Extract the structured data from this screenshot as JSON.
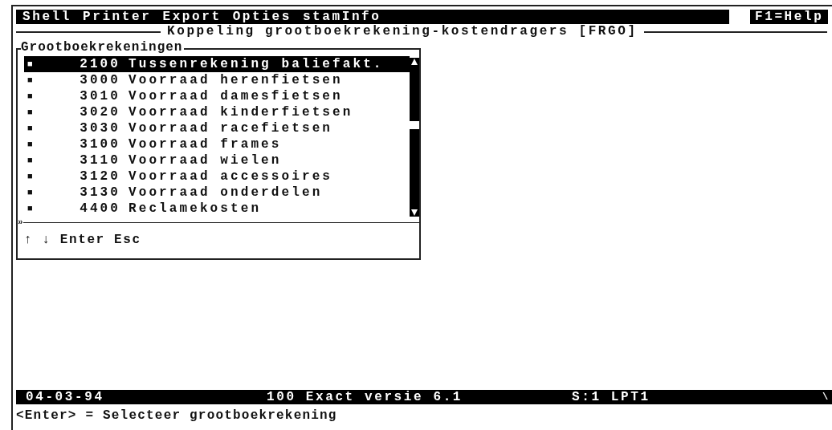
{
  "menu_bar": {
    "items": [
      {
        "label": "Shell"
      },
      {
        "label": "Printer"
      },
      {
        "label": "Export"
      },
      {
        "label": "Opties"
      },
      {
        "label": "stamInfo"
      }
    ],
    "help": "F1=Help"
  },
  "screen_title": "Koppeling grootboekrekening-kostendragers [FRGO]",
  "list_box": {
    "title": "Grootboekrekeningen",
    "items": [
      {
        "marker": "■",
        "code": "2100",
        "name": "Tussenrekening baliefakt.",
        "selected": true
      },
      {
        "marker": "■",
        "code": "3000",
        "name": "Voorraad herenfietsen",
        "selected": false
      },
      {
        "marker": "■",
        "code": "3010",
        "name": "Voorraad damesfietsen",
        "selected": false
      },
      {
        "marker": "■",
        "code": "3020",
        "name": "Voorraad kinderfietsen",
        "selected": false
      },
      {
        "marker": "■",
        "code": "3030",
        "name": "Voorraad racefietsen",
        "selected": false
      },
      {
        "marker": "■",
        "code": "3100",
        "name": "Voorraad frames",
        "selected": false
      },
      {
        "marker": "■",
        "code": "3110",
        "name": "Voorraad wielen",
        "selected": false
      },
      {
        "marker": "■",
        "code": "3120",
        "name": "Voorraad accessoires",
        "selected": false
      },
      {
        "marker": "■",
        "code": "3130",
        "name": "Voorraad onderdelen",
        "selected": false
      },
      {
        "marker": "■",
        "code": "4400",
        "name": "Reclamekosten",
        "selected": false
      }
    ],
    "more_marker": "»",
    "keys": "↑ ↓ Enter Esc"
  },
  "status_bar": {
    "date": "04-03-94",
    "version": "100 Exact versie 6.1",
    "port": "S:1 LPT1",
    "mark": "\\"
  },
  "hint": "<Enter> = Selecteer grootboekrekening"
}
